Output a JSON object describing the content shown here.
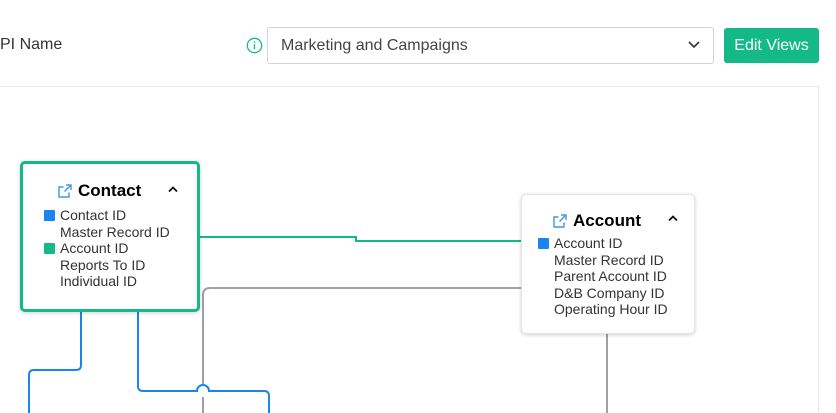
{
  "header": {
    "label_text": "PI Name",
    "info_icon": "info-circle-icon",
    "select_value": "Marketing and Campaigns",
    "edit_button": "Edit Views"
  },
  "entities": {
    "contact": {
      "title": "Contact",
      "fields": [
        {
          "name": "Contact ID",
          "key": "primary"
        },
        {
          "name": "Master Record ID",
          "key": ""
        },
        {
          "name": "Account ID",
          "key": "foreign"
        },
        {
          "name": "Reports To ID",
          "key": ""
        },
        {
          "name": "Individual ID",
          "key": ""
        }
      ]
    },
    "account": {
      "title": "Account",
      "fields": [
        {
          "name": "Account ID",
          "key": "primary"
        },
        {
          "name": "Master Record ID",
          "key": ""
        },
        {
          "name": "Parent Account ID",
          "key": ""
        },
        {
          "name": "D&B Company ID",
          "key": ""
        },
        {
          "name": "Operating Hour ID",
          "key": ""
        }
      ]
    }
  },
  "colors": {
    "accent": "#13b987",
    "primary_key": "#1a85f0",
    "foreign_key": "#13b987",
    "link_grey": "#a0a0a0"
  }
}
